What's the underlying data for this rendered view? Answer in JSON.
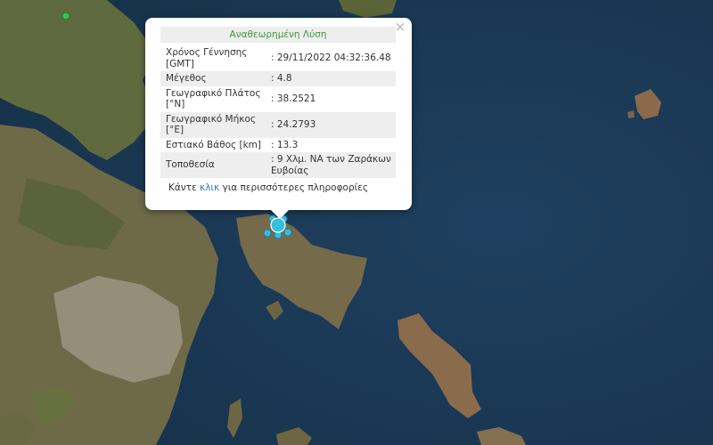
{
  "popup": {
    "title": "Αναθεωρημένη Λύση",
    "close_glyph": "×",
    "rows": [
      {
        "label": "Χρόνος Γέννησης [GMT]",
        "value": ": 29/11/2022 04:32:36.48"
      },
      {
        "label": "Μέγεθος",
        "value": ": 4.8"
      },
      {
        "label": "Γεωγραφικό Πλάτος [°N]",
        "value": ": 38.2521"
      },
      {
        "label": "Γεωγραφικό Μήκος [°E]",
        "value": ": 24.2793"
      },
      {
        "label": "Εστιακό Βάθος [km]",
        "value": ": 13.3"
      },
      {
        "label": "Τοποθεσία",
        "value": ": 9 Χλμ. ΝΑ των Ζαράκων Ευβοίας"
      }
    ],
    "footer_prefix": "Κάντε ",
    "footer_link": "κλικ",
    "footer_suffix": " για περισσότερες πληροφορίες"
  },
  "map": {
    "colors": {
      "sea": "#1d3a52",
      "land": "#6b6a45",
      "urban": "#a09a8c",
      "marker": "#35c0e0"
    },
    "icons": {
      "epicenter": "epicenter-marker-icon",
      "station": "station-dot-icon"
    }
  }
}
